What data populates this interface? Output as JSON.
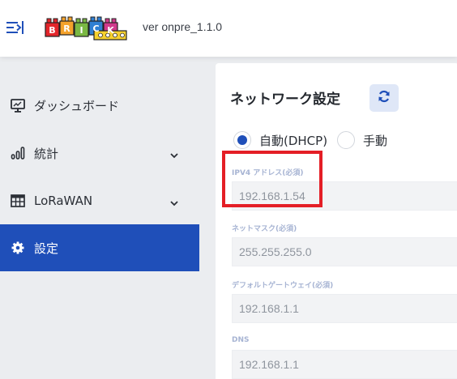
{
  "header": {
    "version": "ver onpre_1.1.0",
    "logo_letters": [
      "B",
      "R",
      "I",
      "C",
      "K"
    ],
    "menu_icon": "menu-toggle-icon"
  },
  "sidebar": {
    "items": [
      {
        "label": "ダッシュボード",
        "icon": "monitor-icon",
        "active": false,
        "expandable": false
      },
      {
        "label": "統計",
        "icon": "bar-chart-icon",
        "active": false,
        "expandable": true
      },
      {
        "label": "LoRaWAN",
        "icon": "table-icon",
        "active": false,
        "expandable": true
      },
      {
        "label": "設定",
        "icon": "gear-icon",
        "active": true,
        "expandable": false
      }
    ]
  },
  "network": {
    "title": "ネットワーク設定",
    "refresh_icon": "refresh-icon",
    "mode_options": [
      {
        "label": "自動(DHCP)",
        "selected": true
      },
      {
        "label": "手動",
        "selected": false
      }
    ],
    "fields": [
      {
        "label": "IPV4 アドレス(必須)",
        "value": "192.168.1.54"
      },
      {
        "label": "ネットマスク(必須)",
        "value": "255.255.255.0"
      },
      {
        "label": "デフォルトゲートウェイ(必須)",
        "value": "192.168.1.1"
      },
      {
        "label": "DNS",
        "value": "192.168.1.1"
      }
    ]
  },
  "colors": {
    "accent": "#1f4fb9",
    "highlight": "#e41e26",
    "label": "#a7b4d3"
  }
}
